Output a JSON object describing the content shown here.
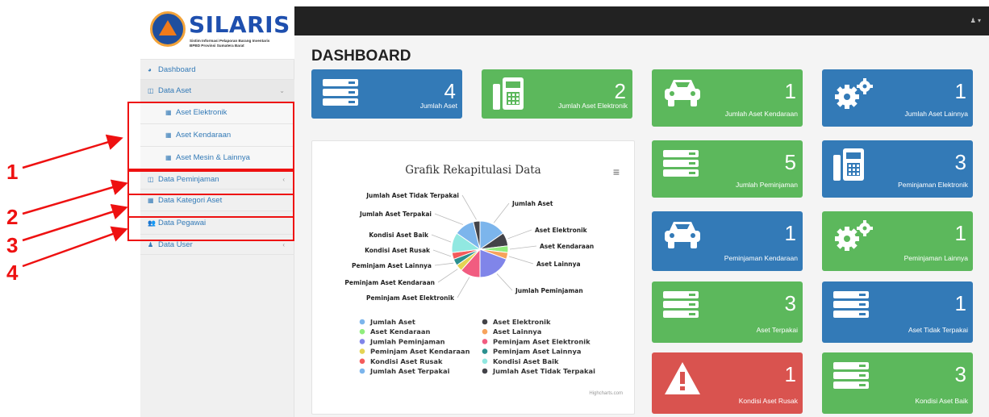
{
  "brand": {
    "title": "SILARIS",
    "subtitle_1": "Sistim Informasi Pelaporan Barang Inventaris",
    "subtitle_2": "BPBD Provinsi Sumatera Barat"
  },
  "sidebar": {
    "items": [
      {
        "label": "Dashboard",
        "icon": "dashboard-icon"
      },
      {
        "label": "Data Aset",
        "icon": "columns-icon"
      },
      {
        "label": "Aset Elektronik",
        "icon": "table-icon"
      },
      {
        "label": "Aset Kendaraan",
        "icon": "table-icon"
      },
      {
        "label": "Aset Mesin & Lainnya",
        "icon": "table-icon"
      },
      {
        "label": "Data Peminjaman",
        "icon": "columns-icon"
      },
      {
        "label": "Data Kategori Aset",
        "icon": "table-icon"
      },
      {
        "label": "Data Pegawai",
        "icon": "users-icon"
      },
      {
        "label": "Data User",
        "icon": "user-icon"
      }
    ]
  },
  "annotations": [
    "1",
    "2",
    "3",
    "4"
  ],
  "header": {
    "user_icon": "user-icon"
  },
  "page_title": "DASHBOARD",
  "tiles": [
    {
      "value": "4",
      "label": "Jumlah Aset",
      "icon": "server-icon",
      "color": "#337ab7"
    },
    {
      "value": "2",
      "label": "Jumlah Aset Elektronik",
      "icon": "fax-icon",
      "color": "#5cb85c"
    },
    {
      "value": "1",
      "label": "Jumlah Aset Kendaraan",
      "icon": "car-icon",
      "color": "#5cb85c"
    },
    {
      "value": "1",
      "label": "Jumlah Aset Lainnya",
      "icon": "cogs-icon",
      "color": "#337ab7"
    },
    {
      "value": "5",
      "label": "Jumlah Peminjaman",
      "icon": "server-icon",
      "color": "#5cb85c"
    },
    {
      "value": "3",
      "label": "Peminjaman Elektronik",
      "icon": "fax-icon",
      "color": "#337ab7"
    },
    {
      "value": "1",
      "label": "Peminjaman Kendaraan",
      "icon": "car-icon",
      "color": "#337ab7"
    },
    {
      "value": "1",
      "label": "Peminjaman Lainnya",
      "icon": "cogs-icon",
      "color": "#5cb85c"
    },
    {
      "value": "3",
      "label": "Aset Terpakai",
      "icon": "server-icon",
      "color": "#5cb85c"
    },
    {
      "value": "1",
      "label": "Aset Tidak Terpakai",
      "icon": "server-icon",
      "color": "#337ab7"
    },
    {
      "value": "1",
      "label": "Kondisi Aset Rusak",
      "icon": "warning-icon",
      "color": "#d9534f"
    },
    {
      "value": "3",
      "label": "Kondisi Aset Baik",
      "icon": "server-icon",
      "color": "#5cb85c"
    }
  ],
  "chart": {
    "menu_icon": "hamburger-icon",
    "credit": "Highcharts.com"
  },
  "chart_data": {
    "type": "pie",
    "title": "Grafik Rekapitulasi Data",
    "slices": [
      {
        "name": "Jumlah Aset",
        "value": 4,
        "color": "#7cb5ec"
      },
      {
        "name": "Aset Elektronik",
        "value": 2,
        "color": "#434348"
      },
      {
        "name": "Aset Kendaraan",
        "value": 1,
        "color": "#90ed7d"
      },
      {
        "name": "Aset Lainnya",
        "value": 1,
        "color": "#f7a35c"
      },
      {
        "name": "Jumlah Peminjaman",
        "value": 5,
        "color": "#8085e9"
      },
      {
        "name": "Peminjam Aset Elektronik",
        "value": 3,
        "color": "#f15c80"
      },
      {
        "name": "Peminjam Aset Kendaraan",
        "value": 1,
        "color": "#e4d354"
      },
      {
        "name": "Peminjam Aset Lainnya",
        "value": 1,
        "color": "#2b908f"
      },
      {
        "name": "Kondisi Aset Rusak",
        "value": 1,
        "color": "#f45b5b"
      },
      {
        "name": "Kondisi Aset Baik",
        "value": 3,
        "color": "#91e8e1"
      },
      {
        "name": "Jumlah Aset Terpakai",
        "value": 3,
        "color": "#7cb5ec"
      },
      {
        "name": "Jumlah Aset Tidak Terpakai",
        "value": 1,
        "color": "#434348"
      }
    ],
    "legend_order": [
      0,
      1,
      2,
      3,
      4,
      5,
      6,
      7,
      8,
      9,
      10,
      11
    ]
  }
}
